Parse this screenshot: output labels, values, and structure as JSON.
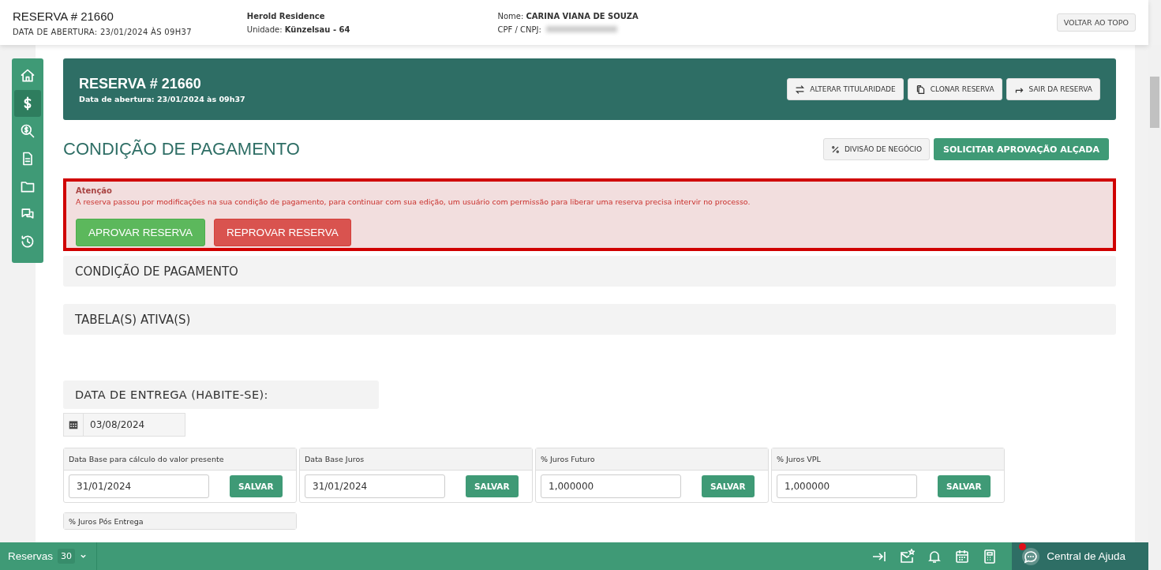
{
  "header": {
    "title": "RESERVA # 21660",
    "subtitle": "DATA DE ABERTURA: 23/01/2024 ÀS 09H37",
    "project": "Herold Residence",
    "unit_label": "Unidade:",
    "unit": "Künzelsau - 64",
    "name_label": "Nome:",
    "name": "CARINA VIANA DE SOUZA",
    "cpf_label": "CPF / CNPJ:",
    "top_button": "VOLTAR AO TOPO"
  },
  "sidebar": {
    "items": [
      {
        "selected": false
      },
      {
        "selected": true
      },
      {
        "selected": false
      },
      {
        "selected": false
      },
      {
        "selected": false
      },
      {
        "selected": false
      },
      {
        "selected": false
      }
    ]
  },
  "banner": {
    "title": "RESERVA # 21660",
    "subtitle": "Data de abertura: 23/01/2024 às 09h37",
    "actions": [
      {
        "label": "ALTERAR TITULARIDADE"
      },
      {
        "label": "CLONAR RESERVA"
      },
      {
        "label": "SAIR DA RESERVA"
      }
    ]
  },
  "page_title": "CONDIÇÃO DE PAGAMENTO",
  "page_actions": [
    {
      "kind": "secondary",
      "label": "DIVISÃO DE NEGÓCIO"
    },
    {
      "kind": "primary",
      "label": "SOLICITAR APROVAÇÃO ALÇADA"
    }
  ],
  "alert": {
    "title": "Atenção",
    "message": "A reserva passou por modificações na sua condição de pagamento, para continuar com sua edição, um usuário com permissão para liberar uma reserva precisa intervir no processo.",
    "buttons": [
      {
        "kind": "approve",
        "label": "APROVAR RESERVA"
      },
      {
        "kind": "reject",
        "label": "REPROVAR RESERVA"
      }
    ]
  },
  "sections": [
    "CONDIÇÃO DE PAGAMENTO",
    "TABELA(S) ATIVA(S)"
  ],
  "delivery": {
    "title": "DATA DE ENTREGA (HABITE-SE):",
    "date": "03/08/2024"
  },
  "fields": [
    {
      "label": "Data Base para cálculo do valor presente",
      "value": "31/01/2024",
      "button": "SALVAR"
    },
    {
      "label": "Data Base Juros",
      "value": "31/01/2024",
      "button": "SALVAR"
    },
    {
      "label": "% Juros Futuro",
      "value": "1,000000",
      "button": "SALVAR"
    },
    {
      "label": "% Juros VPL",
      "value": "1,000000",
      "button": "SALVAR"
    }
  ],
  "partial_field": {
    "label": "% Juros Pós Entrega"
  },
  "bottom_bar": {
    "label": "Reservas",
    "count": "30",
    "help": "Central de Ajuda",
    "help_notification": true
  }
}
